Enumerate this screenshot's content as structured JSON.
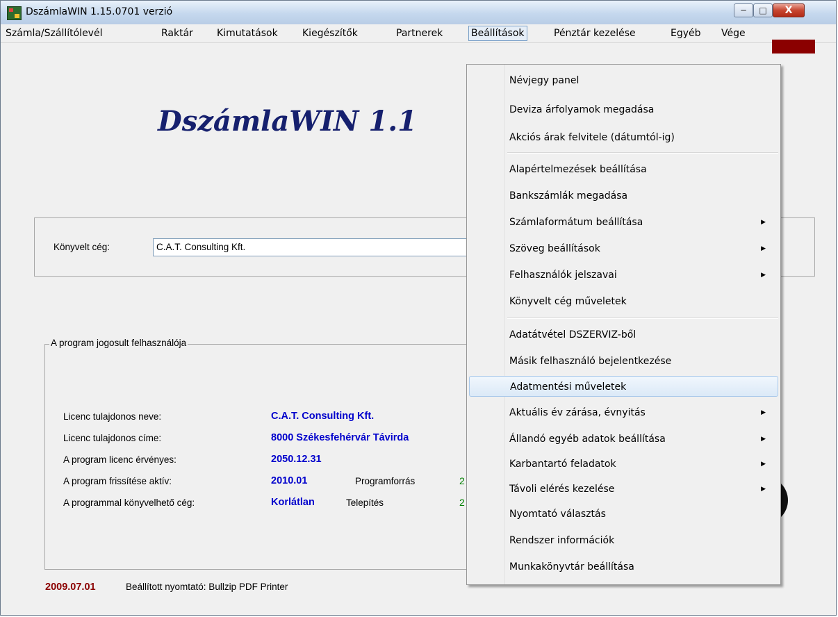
{
  "window": {
    "title": "DszámlaWIN 1.15.0701 verzió",
    "controls": {
      "minimize": "─",
      "maximize": "□",
      "close": "X"
    }
  },
  "menubar": {
    "items": [
      {
        "label": "Számla/Szállítólevél"
      },
      {
        "label": "Raktár"
      },
      {
        "label": "Kimutatások"
      },
      {
        "label": "Kiegészítők"
      },
      {
        "label": "Partnerek"
      },
      {
        "label": "Beállítások",
        "active": true
      },
      {
        "label": "Pénztár kezelése"
      },
      {
        "label": "Egyéb"
      },
      {
        "label": "Vége"
      }
    ]
  },
  "main": {
    "big_title": "DszámlaWIN 1.1",
    "company_label": "Könyvelt cég:",
    "company_value": "C.A.T. Consulting Kft."
  },
  "license": {
    "legend": "A program jogosult felhasználója",
    "rows": [
      {
        "label": "Licenc tulajdonos neve:",
        "value": "C.A.T. Consulting Kft."
      },
      {
        "label": "Licenc tulajdonos címe:",
        "value": "8000 Székesfehérvár Távirda"
      },
      {
        "label": "A program licenc érvényes:",
        "value": "2050.12.31"
      },
      {
        "label": "A program frissítése aktív:",
        "value": "2010.01",
        "extra_label": "Programforrás",
        "extra_value": "2"
      },
      {
        "label": "A programmal könyvelhető cég:",
        "value": "Korlátlan",
        "extra_label": "Telepítés",
        "extra_value": "2"
      }
    ]
  },
  "footer": {
    "date": "2009.07.01",
    "printer": "Beállított nyomtató: Bullzip PDF Printer"
  },
  "dropdown": {
    "items": [
      {
        "label": "Névjegy panel"
      },
      {
        "label": "Deviza árfolyamok megadása"
      },
      {
        "label": "Akciós árak felvitele (dátumtól-ig)"
      },
      {
        "label": "Alapértelmezések beállítása"
      },
      {
        "label": "Bankszámlák megadása"
      },
      {
        "label": "Számlaformátum beállítása",
        "submenu": true
      },
      {
        "label": "Szöveg beállítások",
        "submenu": true
      },
      {
        "label": "Felhasználók jelszavai",
        "submenu": true
      },
      {
        "label": "Könyvelt cég műveletek"
      },
      {
        "label": "Adatátvétel DSZERVIZ-ből"
      },
      {
        "label": "Másik felhasználó bejelentkezése"
      },
      {
        "label": "Adatmentési műveletek",
        "highlighted": true
      },
      {
        "label": "Aktuális év zárása, évnyitás",
        "submenu": true
      },
      {
        "label": "Állandó egyéb adatok beállítása",
        "submenu": true
      },
      {
        "label": "Karbantartó feladatok",
        "submenu": true
      },
      {
        "label": "Távoli elérés kezelése",
        "submenu": true
      },
      {
        "label": "Nyomtató választás"
      },
      {
        "label": "Rendszer információk"
      },
      {
        "label": "Munkakönyvtár beállítása"
      }
    ],
    "submenu_arrow": "▶"
  }
}
